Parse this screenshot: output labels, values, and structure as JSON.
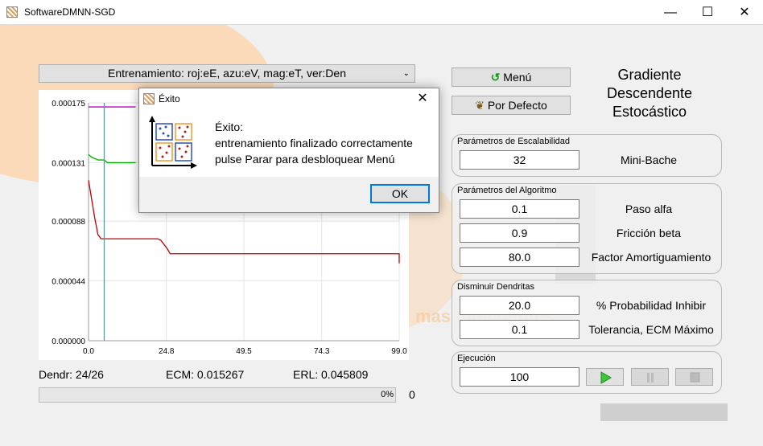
{
  "window": {
    "title": "SoftwareDMNN-SGD",
    "minimize": "—",
    "maximize": "☐",
    "close": "✕"
  },
  "combo": {
    "value": "Entrenamiento: roj:eE, azu:eV, mag:eT, ver:Den"
  },
  "chart_data": {
    "type": "line",
    "title": "",
    "xlabel": "",
    "ylabel": "",
    "xlim": [
      0,
      99
    ],
    "ylim": [
      0,
      0.000175
    ],
    "x_ticks": [
      "0.0",
      "24.8",
      "49.5",
      "74.3",
      "99.0"
    ],
    "y_ticks": [
      "0.000000",
      "0.000044",
      "0.000088",
      "0.000131",
      "0.000175"
    ],
    "series": [
      {
        "color": "#c00000",
        "points": [
          [
            0,
            0.000118
          ],
          [
            1,
            0.000104
          ],
          [
            2,
            9e-05
          ],
          [
            3,
            7.8e-05
          ],
          [
            4,
            7.5e-05
          ],
          [
            6,
            7.5e-05
          ],
          [
            22,
            7.5e-05
          ],
          [
            23,
            7.4e-05
          ],
          [
            25,
            6.8e-05
          ],
          [
            26,
            6.4e-05
          ],
          [
            60,
            6.4e-05
          ],
          [
            99,
            6.4e-05
          ],
          [
            99,
            5.7e-05
          ]
        ]
      },
      {
        "color": "#00b000",
        "points": [
          [
            0,
            0.000137
          ],
          [
            1,
            0.000135
          ],
          [
            3,
            0.000133
          ],
          [
            5,
            0.000133
          ],
          [
            6,
            0.000131
          ],
          [
            15,
            0.000131
          ]
        ]
      },
      {
        "color": "#c000c0",
        "points": [
          [
            0,
            0.000172
          ],
          [
            15,
            0.000172
          ]
        ]
      },
      {
        "color": "#00c0c0",
        "points": [
          [
            5,
            0.000175
          ],
          [
            5,
            0.0
          ]
        ]
      }
    ]
  },
  "buttons": {
    "menu": "Menú",
    "default": "Por Defecto"
  },
  "heading": [
    "Gradiente",
    "Descendente",
    "Estocástico"
  ],
  "scalability": {
    "title": "Parámetros de Escalabilidad",
    "batch_value": "32",
    "batch_label": "Mini-Bache"
  },
  "algorithm": {
    "title": "Parámetros del Algoritmo",
    "alpha_value": "0.1",
    "alpha_label": "Paso alfa",
    "beta_value": "0.9",
    "beta_label": "Fricción beta",
    "damping_value": "80.0",
    "damping_label": "Factor Amortiguamiento"
  },
  "dendrites": {
    "title": "Disminuir Dendritas",
    "prob_value": "20.0",
    "prob_label": "% Probabilidad Inhibir",
    "tol_value": "0.1",
    "tol_label": "Tolerancia, ECM Máximo"
  },
  "execution": {
    "title": "Ejecución",
    "epochs_value": "100"
  },
  "stats": {
    "dendr": "Dendr: 24/26",
    "ecm": "ECM: 0.015267",
    "erl": "ERL: 0.045809"
  },
  "progress": {
    "percent_label": "0%",
    "fraction": 0,
    "count": "0"
  },
  "dialog": {
    "title": "Éxito",
    "line1": "Éxito:",
    "line2": "entrenamiento finalizado correctamente",
    "line3": "pulse Parar para desbloquear Menú",
    "ok": "OK"
  },
  "background_text": "mas inteligentes",
  "colors": {
    "accent_orange": "#f7a64a",
    "dialog_focus": "#0078d7"
  }
}
